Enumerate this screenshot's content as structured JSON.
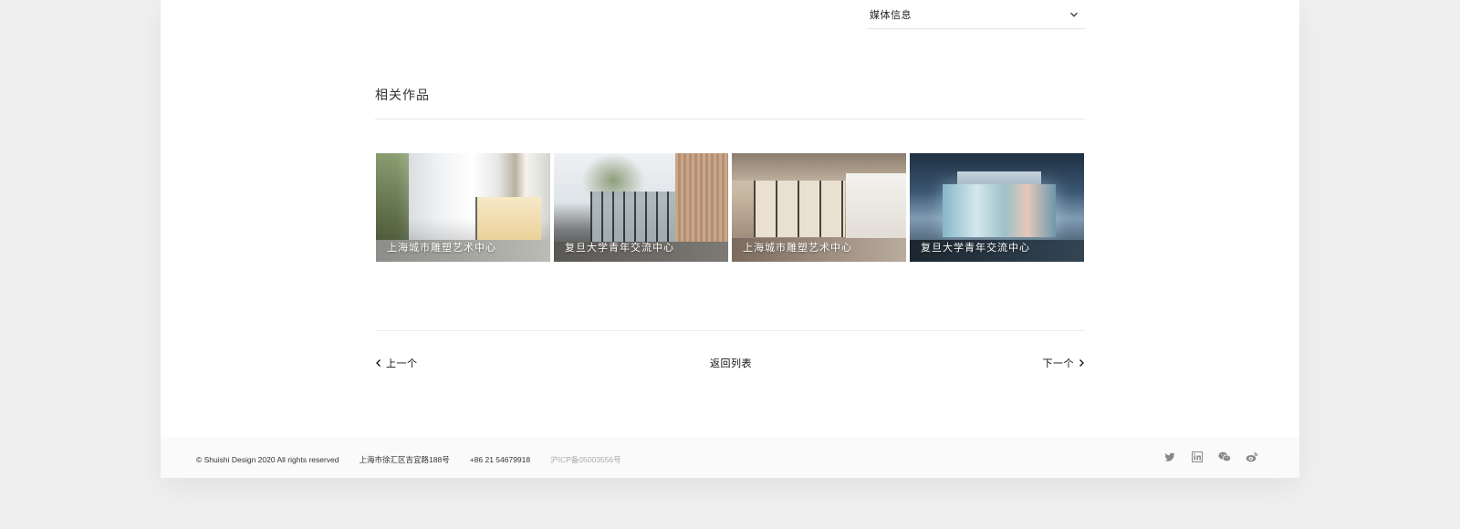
{
  "accordion": {
    "label": "媒体信息"
  },
  "related": {
    "title": "相关作品",
    "items": [
      {
        "caption": "上海城市雕塑艺术中心"
      },
      {
        "caption": "复旦大学青年交流中心"
      },
      {
        "caption": "上海城市雕塑艺术中心"
      },
      {
        "caption": "复旦大学青年交流中心"
      }
    ]
  },
  "pager": {
    "prev_label": "上一个",
    "back_label": "返回列表",
    "next_label": "下一个"
  },
  "footer": {
    "copyright": "© Shuishi Design 2020 All rights reserved",
    "address": "上海市徐汇区吉宜路188号",
    "phone": "+86 21 54679918",
    "icp": "沪ICP备05003556号",
    "social_icons": [
      "twitter-icon",
      "linkedin-icon",
      "wechat-icon",
      "weibo-icon"
    ]
  },
  "colors": {
    "background": "#efefef",
    "card": "#ffffff",
    "footer": "#fafafa",
    "text": "#222222",
    "muted": "#aaaaaa"
  }
}
